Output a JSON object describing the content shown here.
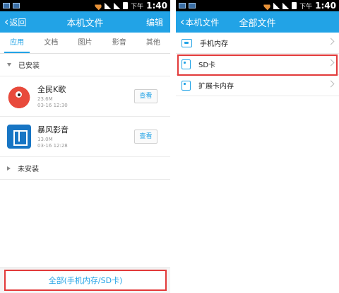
{
  "left_screen": {
    "status": {
      "period": "下午",
      "time": "1:40"
    },
    "header": {
      "back_label": "返回",
      "title": "本机文件",
      "edit_label": "编辑"
    },
    "tabs": [
      {
        "label": "应用",
        "active": true
      },
      {
        "label": "文档",
        "active": false
      },
      {
        "label": "图片",
        "active": false
      },
      {
        "label": "影音",
        "active": false
      },
      {
        "label": "其他",
        "active": false
      }
    ],
    "installed_section": "已安装",
    "apps": [
      {
        "name": "全民K歌",
        "size": "23.6M",
        "date": "03-16 12:30",
        "action": "查看",
        "icon": "karaoke-app-icon",
        "icon_color": "#e84a3c"
      },
      {
        "name": "暴风影音",
        "size": "13.0M",
        "date": "03-16 12:28",
        "action": "查看",
        "icon": "video-player-app-icon",
        "icon_color": "#1775c4"
      }
    ],
    "not_installed_section": "未安装",
    "bottom_button": "全部(手机内存/SD卡)"
  },
  "right_screen": {
    "status": {
      "period": "下午",
      "time": "1:40"
    },
    "header": {
      "back_label": "本机文件",
      "title": "全部文件"
    },
    "items": [
      {
        "label": "手机内存",
        "icon": "phone-memory-icon"
      },
      {
        "label": "SD卡",
        "icon": "sd-card-icon"
      },
      {
        "label": "扩展卡内存",
        "icon": "extended-card-icon"
      }
    ]
  },
  "colors": {
    "accent": "#22a3e6",
    "highlight": "#e23a3a"
  }
}
